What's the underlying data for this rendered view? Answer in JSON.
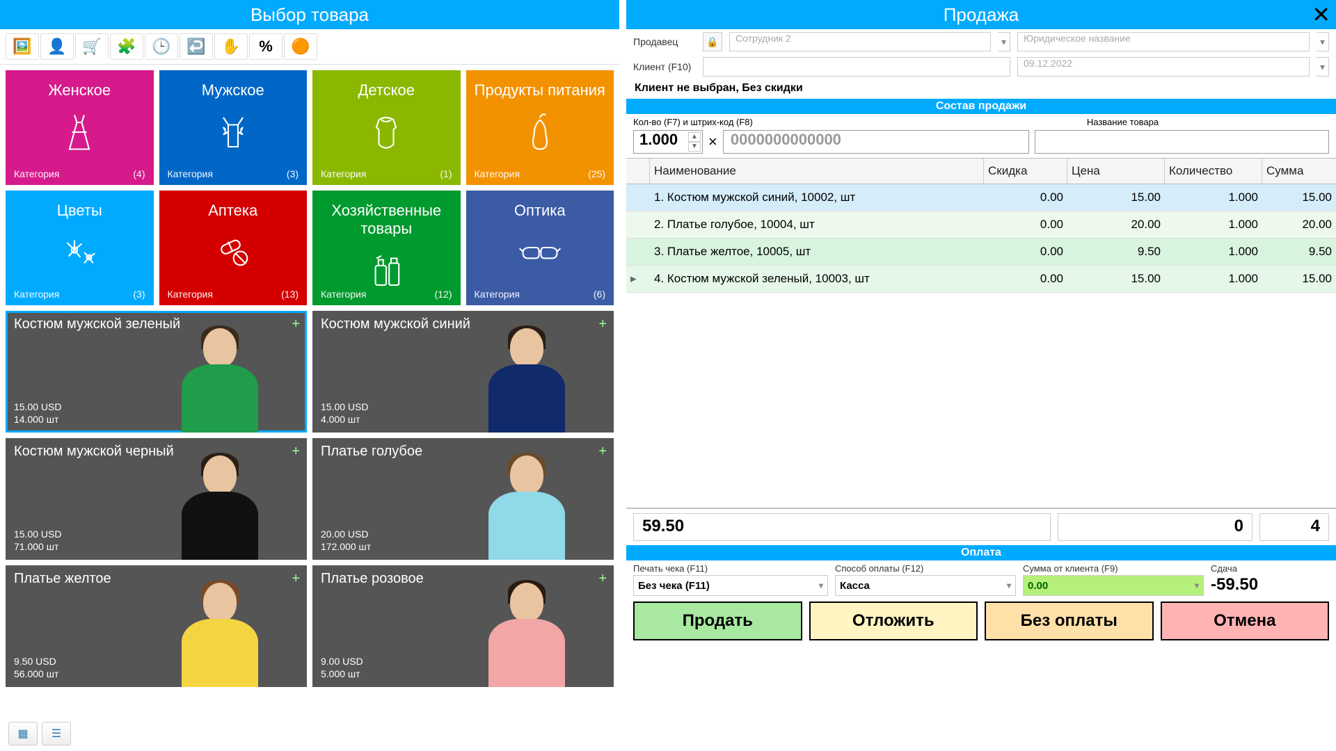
{
  "left": {
    "title": "Выбор товара",
    "categories": [
      {
        "title": "Женское",
        "label": "Категория",
        "count": "(4)",
        "bg": "#d61a8c",
        "icon": "dress"
      },
      {
        "title": "Мужское",
        "label": "Категория",
        "count": "(3)",
        "bg": "#0067c7",
        "icon": "bowtie"
      },
      {
        "title": "Детское",
        "label": "Категория",
        "count": "(1)",
        "bg": "#8ab800",
        "icon": "onesie"
      },
      {
        "title": "Продукты питания",
        "label": "Категория",
        "count": "(25)",
        "bg": "#f39200",
        "icon": "pear"
      },
      {
        "title": "Цветы",
        "label": "Категория",
        "count": "(3)",
        "bg": "#00aaff",
        "icon": "flower"
      },
      {
        "title": "Аптека",
        "label": "Категория",
        "count": "(13)",
        "bg": "#d40000",
        "icon": "pills"
      },
      {
        "title": "Хозяйственные товары",
        "label": "Категория",
        "count": "(12)",
        "bg": "#009a2e",
        "icon": "cleaning"
      },
      {
        "title": "Оптика",
        "label": "Категория",
        "count": "(6)",
        "bg": "#3b5ba5",
        "icon": "glasses"
      }
    ],
    "products": [
      {
        "name": "Костюм мужской зеленый",
        "price": "15.00 USD",
        "stock": "14.000 шт",
        "selected": true,
        "hair": "#3b2b1c",
        "body": "#1f9d4a"
      },
      {
        "name": "Костюм мужской синий",
        "price": "15.00 USD",
        "stock": "4.000 шт",
        "selected": false,
        "hair": "#2b1f14",
        "body": "#102a6b"
      },
      {
        "name": "Костюм мужской черный",
        "price": "15.00 USD",
        "stock": "71.000 шт",
        "selected": false,
        "hair": "#2b1f14",
        "body": "#111"
      },
      {
        "name": "Платье голубое",
        "price": "20.00 USD",
        "stock": "172.000 шт",
        "selected": false,
        "hair": "#6b4a2a",
        "body": "#8fd9e8"
      },
      {
        "name": "Платье желтое",
        "price": "9.50 USD",
        "stock": "56.000 шт",
        "selected": false,
        "hair": "#7a4a28",
        "body": "#f5d442"
      },
      {
        "name": "Платье розовое",
        "price": "9.00 USD",
        "stock": "5.000 шт",
        "selected": false,
        "hair": "#2a1a10",
        "body": "#f2a6a6"
      }
    ]
  },
  "right": {
    "title": "Продажа",
    "seller_label": "Продавец",
    "seller_value": "Сотрудник 2",
    "legal_value": "Юридическое название",
    "client_label": "Клиент (F10)",
    "date_value": "09.12.2022",
    "status": "Клиент не выбран, Без скидки",
    "section1": "Состав продажи",
    "qty_label": "Кол-во (F7) и штрих-код (F8)",
    "name_label": "Название товара",
    "qty_value": "1.000",
    "barcode_placeholder": "0000000000000",
    "columns": {
      "c1": "Наименование",
      "c2": "Скидка",
      "c3": "Цена",
      "c4": "Количество",
      "c5": "Сумма"
    },
    "rows": [
      {
        "idx": "1.",
        "name": "Костюм мужской синий, 10002, шт",
        "discount": "0.00",
        "price": "15.00",
        "qty": "1.000",
        "sum": "15.00"
      },
      {
        "idx": "2.",
        "name": "Платье голубое, 10004, шт",
        "discount": "0.00",
        "price": "20.00",
        "qty": "1.000",
        "sum": "20.00"
      },
      {
        "idx": "3.",
        "name": "Платье желтое, 10005, шт",
        "discount": "0.00",
        "price": "9.50",
        "qty": "1.000",
        "sum": "9.50"
      },
      {
        "idx": "4.",
        "name": "Костюм мужской зеленый, 10003, шт",
        "discount": "0.00",
        "price": "15.00",
        "qty": "1.000",
        "sum": "15.00"
      }
    ],
    "totals": {
      "sum": "59.50",
      "t2": "0",
      "t3": "4"
    },
    "section2": "Оплата",
    "pay": {
      "receipt_label": "Печать чека (F11)",
      "receipt_value": "Без чека (F11)",
      "method_label": "Способ оплаты (F12)",
      "method_value": "Касса",
      "amount_label": "Сумма от клиента (F9)",
      "amount_value": "0.00",
      "change_label": "Сдача",
      "change_value": "-59.50"
    },
    "buttons": {
      "sell": "Продать",
      "hold": "Отложить",
      "nopay": "Без оплаты",
      "cancel": "Отмена"
    }
  }
}
